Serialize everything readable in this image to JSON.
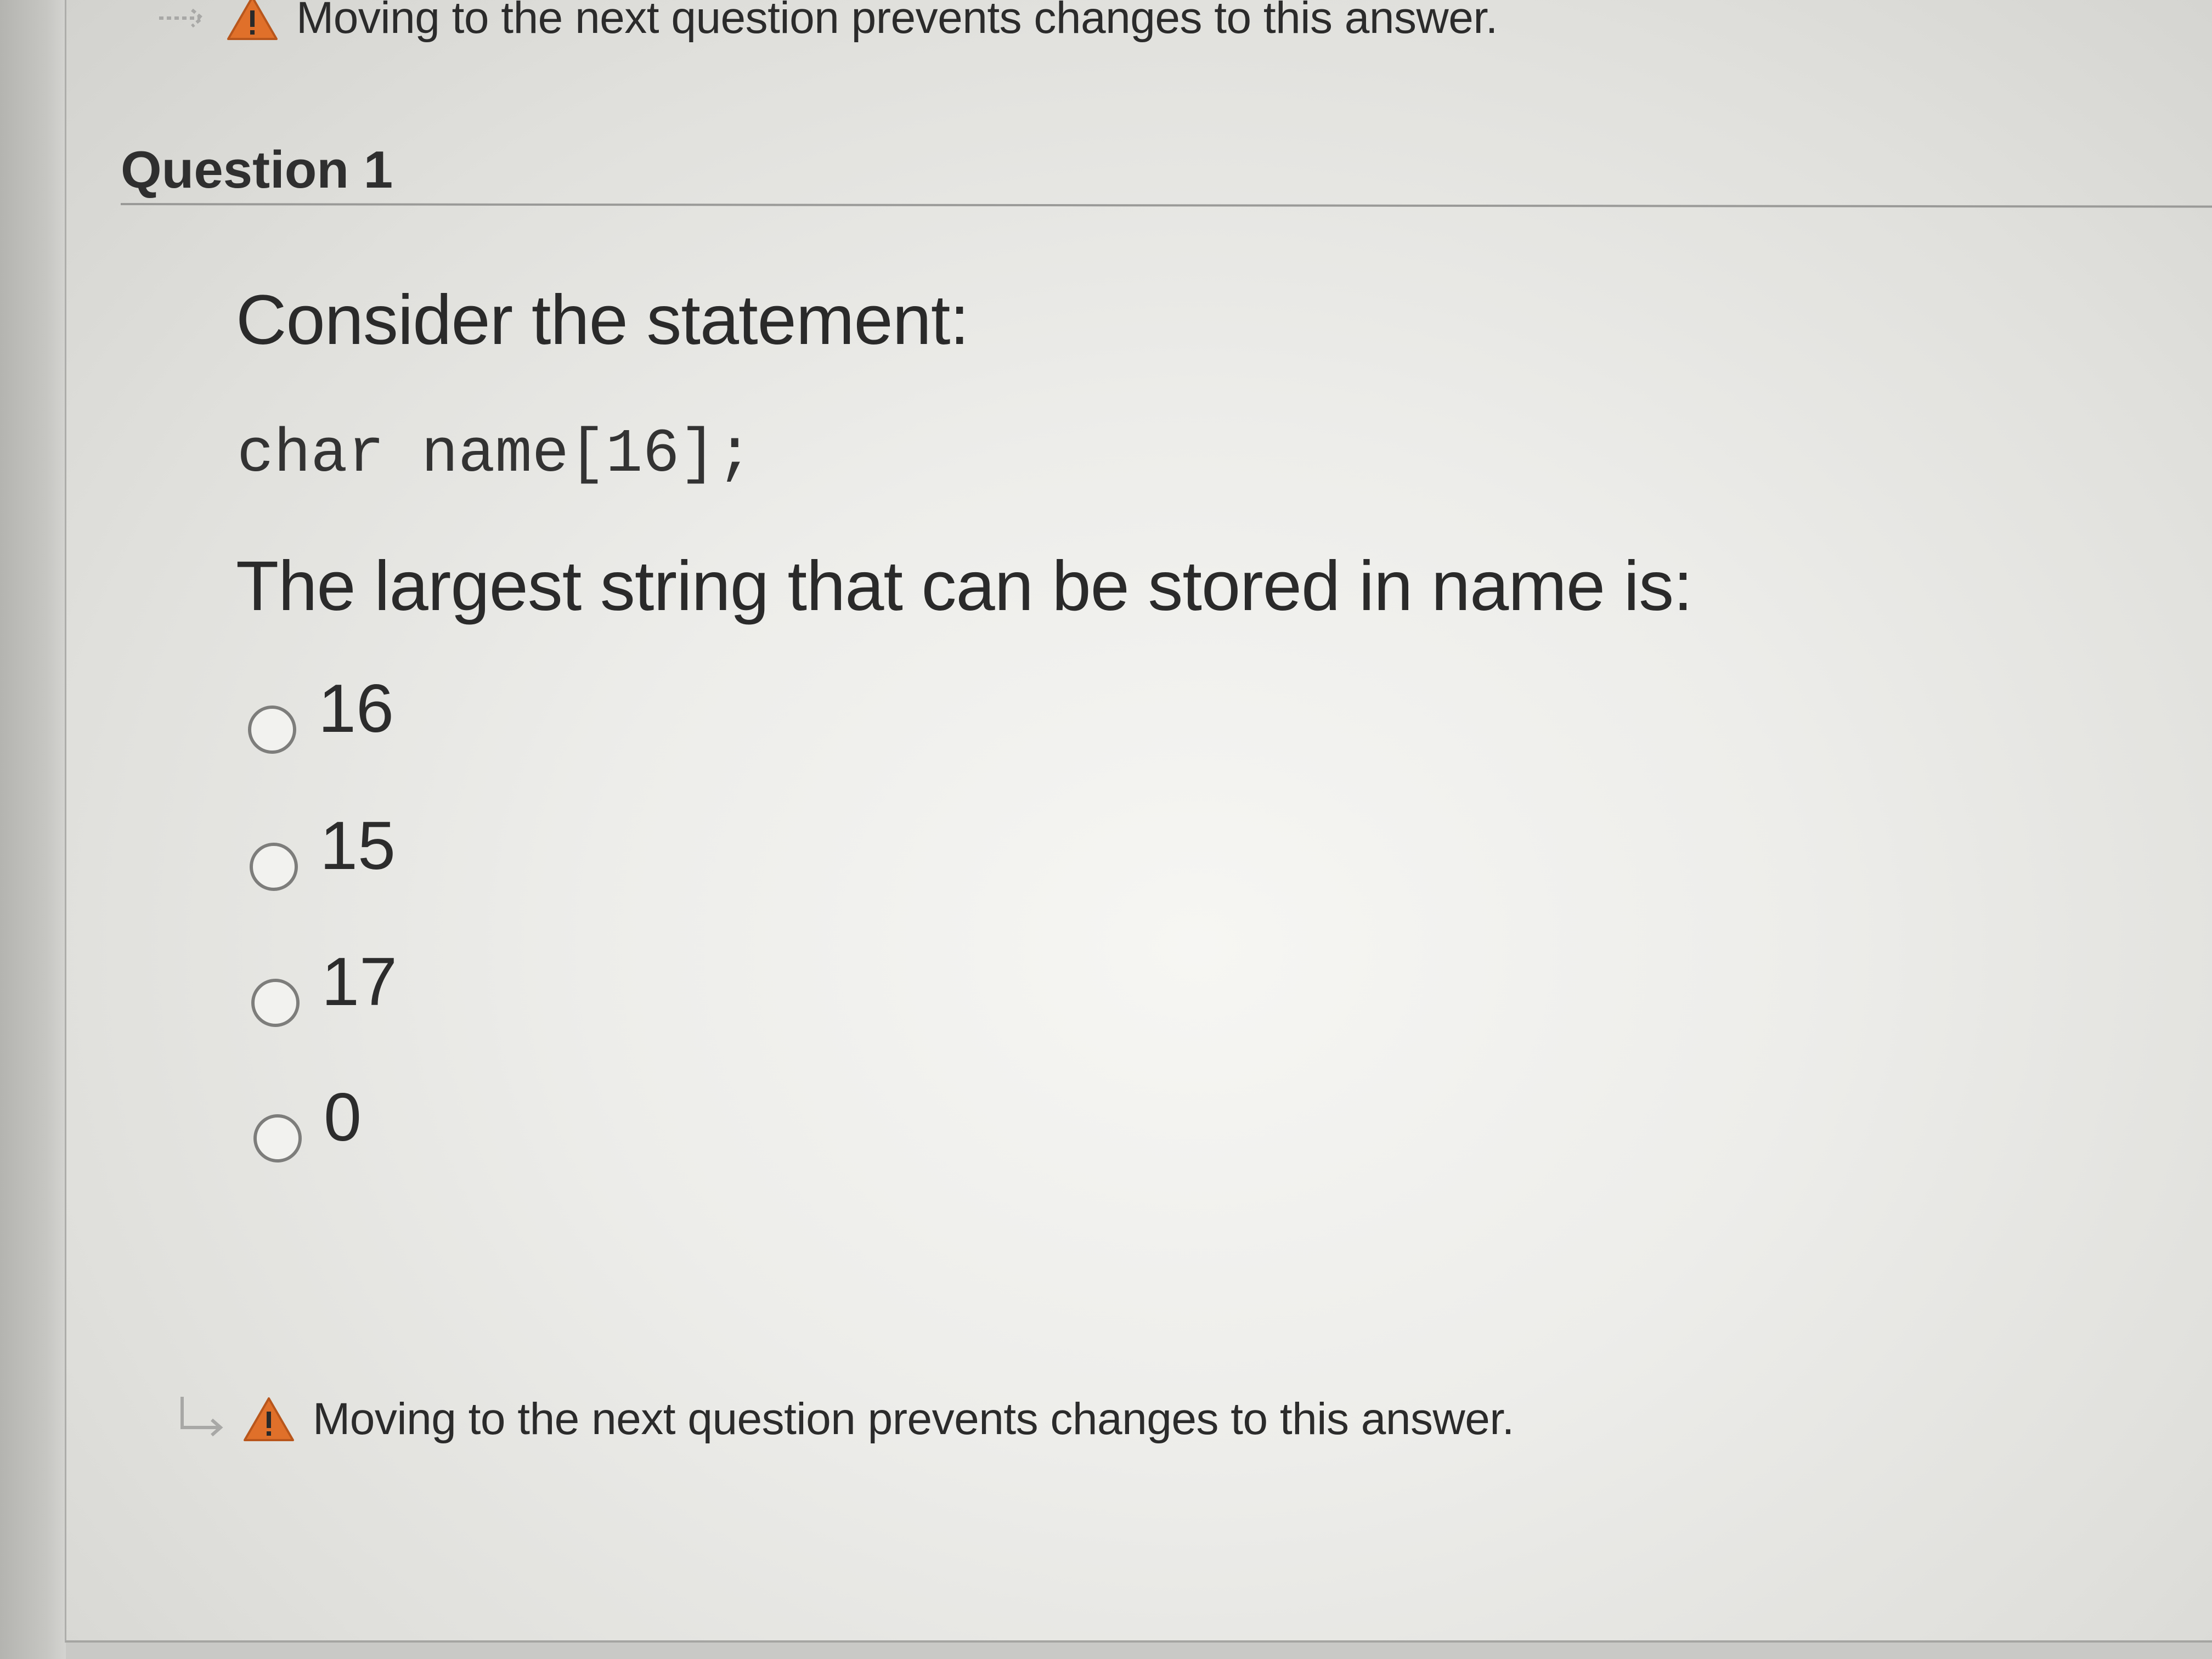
{
  "warning": {
    "text": "Moving to the next question prevents changes to this answer."
  },
  "question": {
    "title": "Question 1",
    "prompt_intro": "Consider the statement:",
    "code": "char name[16];",
    "prompt_question": "The largest string that can be stored in name is:",
    "options": [
      {
        "label": "16"
      },
      {
        "label": "15"
      },
      {
        "label": "17"
      },
      {
        "label": "0"
      }
    ]
  },
  "icons": {
    "arrow": "arrow-icon",
    "warning": "warning-icon",
    "warning_color": "#e0702a"
  }
}
